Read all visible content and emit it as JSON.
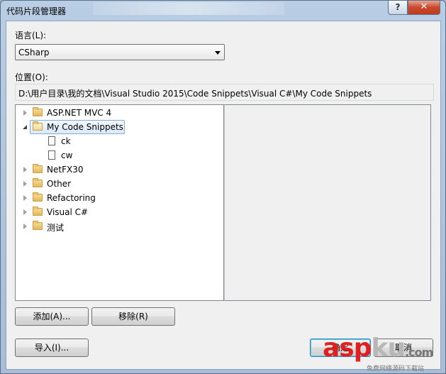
{
  "window": {
    "title": "代码片段管理器",
    "help": "?",
    "close": "✕"
  },
  "language": {
    "label": "语言(L):",
    "value": "CSharp"
  },
  "location": {
    "label": "位置(O):",
    "path": "D:\\用户目录\\我的文档\\Visual Studio 2015\\Code Snippets\\Visual C#\\My Code Snippets"
  },
  "tree": {
    "items": [
      {
        "label": "ASP.NET MVC 4"
      },
      {
        "label": "My Code Snippets",
        "children": [
          {
            "label": "ck"
          },
          {
            "label": "cw"
          }
        ]
      },
      {
        "label": "NetFX30"
      },
      {
        "label": "Other"
      },
      {
        "label": "Refactoring"
      },
      {
        "label": "Visual C#"
      },
      {
        "label": "测试"
      }
    ]
  },
  "buttons": {
    "add": "添加(A)...",
    "remove": "移除(R)",
    "import": "导入(I)...",
    "ok": "确定",
    "cancel": "取消"
  },
  "watermark": {
    "main": "asp",
    "accent": "ku",
    "suffix": ".com",
    "sub": "免费网络源码下载站"
  }
}
